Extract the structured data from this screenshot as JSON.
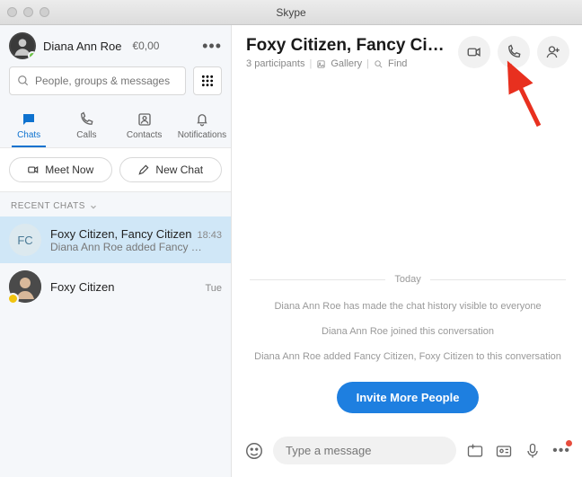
{
  "window": {
    "title": "Skype"
  },
  "profile": {
    "name": "Diana Ann Roe",
    "balance": "€0,00"
  },
  "search": {
    "placeholder": "People, groups & messages"
  },
  "tabs": {
    "chats": "Chats",
    "calls": "Calls",
    "contacts": "Contacts",
    "notifications": "Notifications"
  },
  "actions": {
    "meetNow": "Meet Now",
    "newChat": "New Chat"
  },
  "sections": {
    "recent": "RECENT CHATS"
  },
  "chats": [
    {
      "avatar_initials": "FC",
      "title": "Foxy Citizen, Fancy Citizen",
      "time": "18:43",
      "preview": "Diana Ann Roe added Fancy …"
    },
    {
      "title": "Foxy Citizen",
      "time": "Tue",
      "preview": ""
    }
  ],
  "header": {
    "title": "Foxy Citizen, Fancy Ci…",
    "participants": "3 participants",
    "gallery": "Gallery",
    "find": "Find"
  },
  "messages": {
    "day": "Today",
    "sys1": "Diana Ann Roe has made the chat history visible to everyone",
    "sys2": "Diana Ann Roe joined this conversation",
    "sys3": "Diana Ann Roe added Fancy Citizen, Foxy Citizen to this conversation",
    "invite": "Invite More People"
  },
  "composer": {
    "placeholder": "Type a message"
  }
}
